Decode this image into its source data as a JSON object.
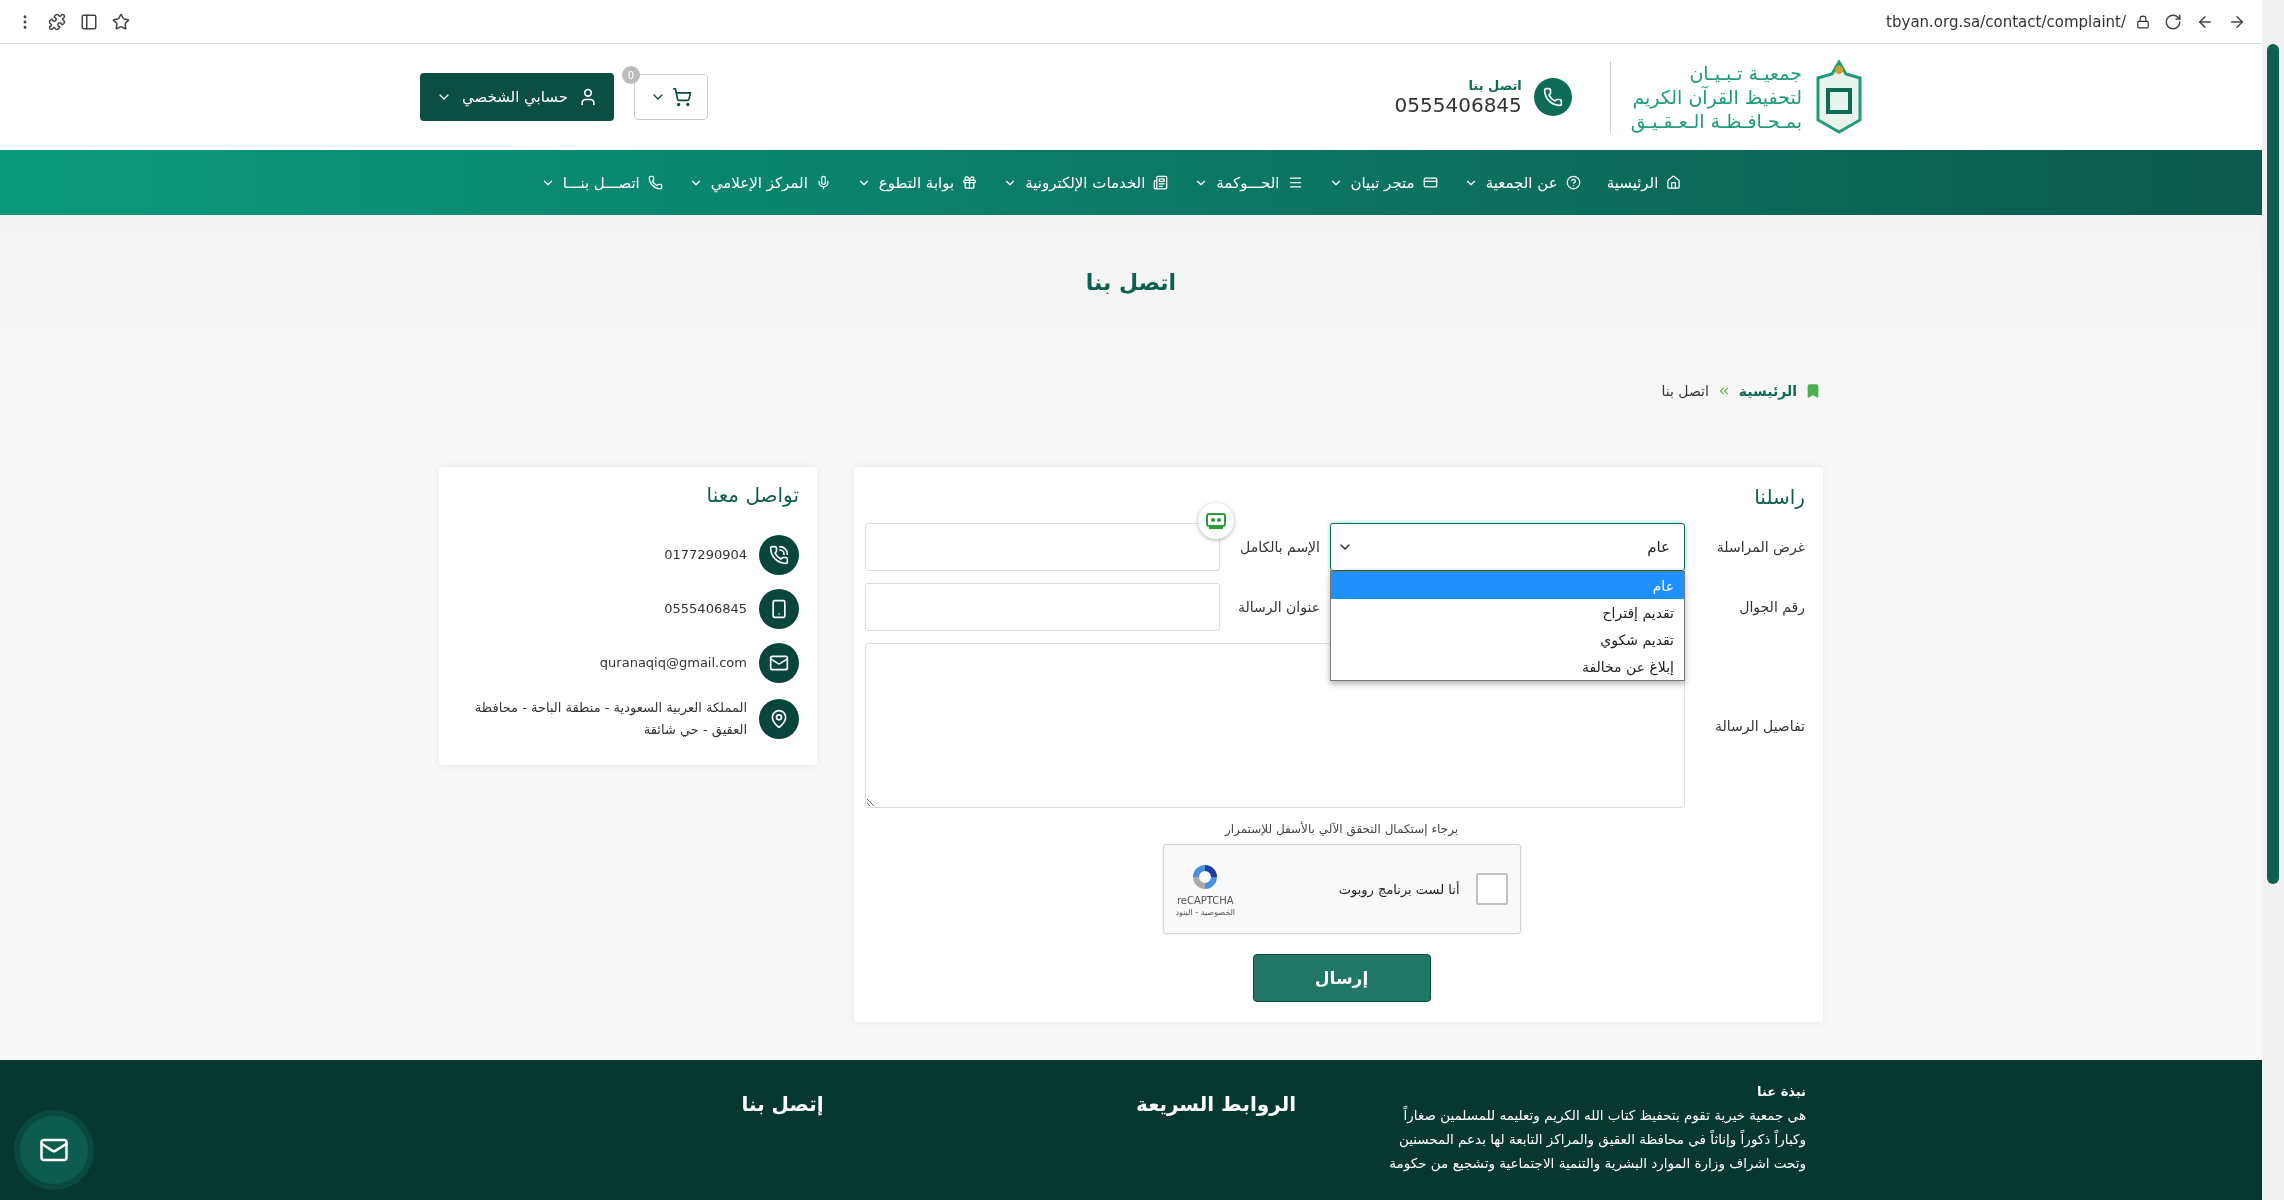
{
  "browser": {
    "url": "tbyan.org.sa/contact/complaint/"
  },
  "header": {
    "org_name": [
      "جمعيـة تـبـيـان",
      "لتحفيظ القرآن الكريم",
      "بمـحـافـظـة الـعـقـيـق"
    ],
    "contact_label": "اتصل بنا",
    "phone": "0555406845",
    "cart_count": "0",
    "account": "حسابي الشخصي"
  },
  "nav": [
    {
      "label": "الرئيسية",
      "kind": "home",
      "dropdown": false
    },
    {
      "label": "عن الجمعية",
      "kind": "question",
      "dropdown": true
    },
    {
      "label": "متجر تبيان",
      "kind": "card",
      "dropdown": true
    },
    {
      "label": "الحـــوكمة",
      "kind": "list",
      "dropdown": true
    },
    {
      "label": "الخدمات الإلكترونية",
      "kind": "news",
      "dropdown": true
    },
    {
      "label": "بوابة التطوع",
      "kind": "gift",
      "dropdown": true
    },
    {
      "label": "المركز الإعلامي",
      "kind": "mic",
      "dropdown": true
    },
    {
      "label": "اتصـــل بنـــا",
      "kind": "phone",
      "dropdown": true
    }
  ],
  "page_title": "اتصل بنا",
  "breadcrumb": [
    {
      "label": "الرئيسية",
      "kind": "link"
    },
    {
      "label": "اتصل بنا",
      "kind": "current"
    }
  ],
  "form": {
    "title": "راسلنا",
    "purpose": {
      "label": "غرض المراسلة",
      "value": "عام",
      "expanded": true,
      "options": [
        {
          "label": "عام",
          "selected": true
        },
        {
          "label": "تقديم إقتراح",
          "selected": false
        },
        {
          "label": "تقديم شكوي",
          "selected": false
        },
        {
          "label": "إبلاغ عن مخالفة",
          "selected": false
        }
      ]
    },
    "full_name": {
      "label": "الإسم بالكامل"
    },
    "mobile": {
      "label": "رقم الجوال"
    },
    "subject": {
      "label": "عنوان الرسالة"
    },
    "details": {
      "label": "تفاصيل الرسالة"
    },
    "captcha_hint": "برجاء إستكمال التحقق الآلي بالأسفل للإستمرار",
    "captcha": {
      "label": "أنا لست برنامج روبوت",
      "checked": false,
      "brand": "reCAPTCHA",
      "links": "الخصوصية - البنود"
    },
    "submit": "إرسال"
  },
  "contact": {
    "title": "تواصل معنا",
    "items": [
      {
        "kind": "phone",
        "text": "0177290904"
      },
      {
        "kind": "mobile",
        "text": "0555406845"
      },
      {
        "kind": "email",
        "text": "quranaqiq@gmail.com"
      },
      {
        "kind": "location",
        "text": "المملكة العربية السعودية - منطقة الباحة - محافظة العقيق - حي شائقة"
      }
    ]
  },
  "footer": {
    "about_title": "نبذة عنا",
    "about_text": "هي جمعية خيرية تقوم بتحفيظ كتاب الله الكريم وتعليمه للمسلمين صغاراً وكباراً ذكوراً وإناثاً في محافظة العقيق والمراكز التابعة لها بدعم المحسنين وتحت اشراف وزارة الموارد البشرية والتنمية الاجتماعية وتشجيع من حكومة",
    "links_title": "الروابط السريعة",
    "contact_title": "إتصل بنا"
  }
}
